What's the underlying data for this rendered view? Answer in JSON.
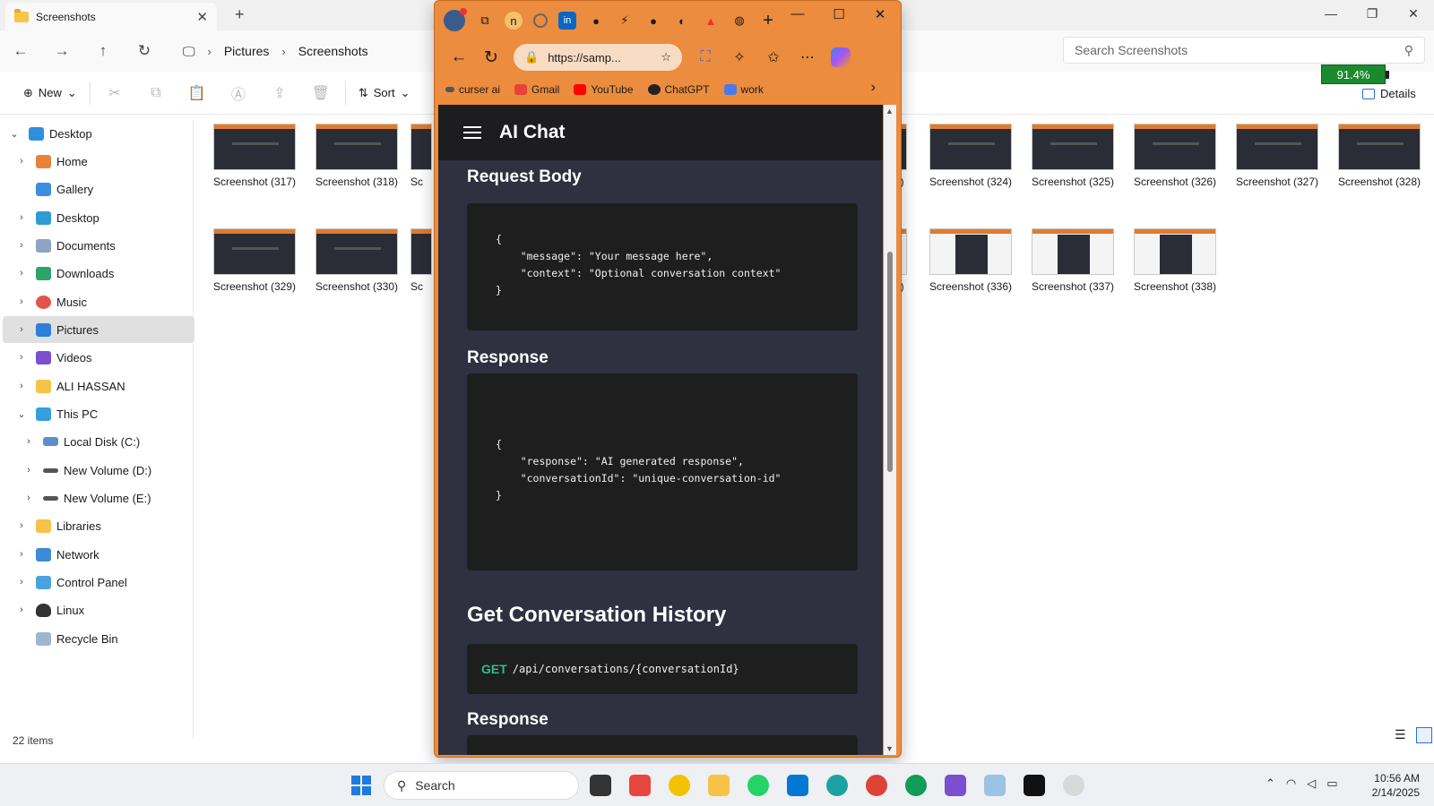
{
  "explorer": {
    "tab_title": "Screenshots",
    "breadcrumb": [
      "Pictures",
      "Screenshots"
    ],
    "search_placeholder": "Search Screenshots",
    "toolbar": {
      "new_label": "New",
      "sort_label": "Sort",
      "details_label": "Details"
    },
    "battery": "91.4%",
    "sidebar": [
      {
        "label": "Desktop",
        "expanded": true
      },
      {
        "label": "Home"
      },
      {
        "label": "Gallery"
      },
      {
        "label": "Desktop"
      },
      {
        "label": "Documents"
      },
      {
        "label": "Downloads"
      },
      {
        "label": "Music"
      },
      {
        "label": "Pictures",
        "selected": true
      },
      {
        "label": "Videos"
      },
      {
        "label": "ALI HASSAN"
      },
      {
        "label": "This PC",
        "expanded": true
      },
      {
        "label": "Local Disk (C:)"
      },
      {
        "label": "New Volume (D:)"
      },
      {
        "label": "New Volume (E:)"
      },
      {
        "label": "Libraries"
      },
      {
        "label": "Network"
      },
      {
        "label": "Control Panel"
      },
      {
        "label": "Linux"
      },
      {
        "label": "Recycle Bin"
      }
    ],
    "files_row1": [
      "Screenshot (317)",
      "Screenshot (318)",
      "Sc",
      "3)",
      "Screenshot (324)",
      "Screenshot (325)",
      "Screenshot (326)",
      "Screenshot (327)",
      "Screenshot (328)"
    ],
    "files_row2": [
      "Screenshot (329)",
      "Screenshot (330)",
      "Sc",
      "5)",
      "Screenshot (336)",
      "Screenshot (337)",
      "Screenshot (338)"
    ],
    "status": "22 items"
  },
  "browser": {
    "url": "https://samp...",
    "bookmarks": [
      "curser ai",
      "Gmail",
      "YouTube",
      "ChatGPT",
      "work"
    ],
    "app_title": "AI Chat",
    "sections": {
      "request_body_title": "Request Body",
      "request_lines": [
        "{",
        "    \"message\": \"Your message here\",",
        "    \"context\": \"Optional conversation context\"",
        "}"
      ],
      "response_title": "Response",
      "response_lines": [
        "{",
        "    \"response\": \"AI generated response\",",
        "    \"conversationId\": \"unique-conversation-id\"",
        "}"
      ],
      "history_title": "Get Conversation History",
      "history_method": "GET",
      "history_path": "/api/conversations/{conversationId}",
      "response2_title": "Response"
    }
  },
  "taskbar": {
    "search_label": "Search",
    "time": "10:56 AM",
    "date": "2/14/2025"
  }
}
